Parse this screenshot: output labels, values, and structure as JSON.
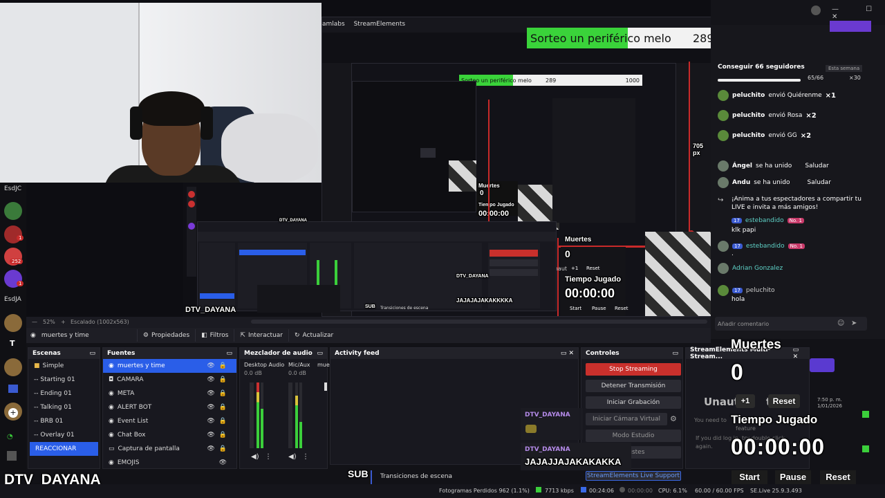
{
  "goal": {
    "title": "Sorteo un periférico melo",
    "current": "289",
    "target": "1000"
  },
  "webcam_name": "DTV_DAYANA",
  "left_labels": [
    "EsdJC",
    "EsdJA"
  ],
  "left_badges": [
    "252",
    "1",
    "1"
  ],
  "obs_menu": [
    "amlabs",
    "StreamElements"
  ],
  "nested": {
    "goal_title": "Sorteo un periférico melo",
    "goal_current": "289",
    "goal_target": "1000",
    "muertes": "Muertes",
    "muertes_val": "0",
    "tiempo": "Tiempo Jugado",
    "tiempo_val": "00:00:00",
    "dim_label": "705 px",
    "start": "Start",
    "pause": "Pause",
    "reset": "Reset",
    "plus": "+1",
    "name": "DTV_DAYANA",
    "sub": "SUB",
    "trans": "Transiciones de escena",
    "jaja": "JAJAJAJAKAKKKKA",
    "unaut": "Unaut"
  },
  "chat": {
    "goal": "Conseguir 66 seguidores",
    "goal_period": "Esta semana",
    "goal_progress": "65/66",
    "goal_reward": "×30",
    "gifts": [
      {
        "user": "peluchito",
        "text": "envió Quiérenme",
        "mult": "×1"
      },
      {
        "user": "peluchito",
        "text": "envió Rosa",
        "mult": "×2"
      },
      {
        "user": "peluchito",
        "text": "envió GG",
        "mult": "×2"
      }
    ],
    "joins": [
      {
        "user": "Ángel",
        "text": "se ha unido",
        "action": "Saludar"
      },
      {
        "user": "Andu",
        "text": "se ha unido",
        "action": "Saludar"
      }
    ],
    "share": "¡Anima a tus espectadores a compartir tu LIVE e invita a más amigos!",
    "messages": [
      {
        "level": "17",
        "user": "estebandido",
        "badge": "No. 1",
        "text": "klk papi"
      },
      {
        "level": "17",
        "user": "estebandido",
        "badge": "No. 1",
        "text": "."
      },
      {
        "user": "Adrian Gonzalez",
        "text": ""
      },
      {
        "level": "17",
        "user": "peluchito",
        "text": "hola"
      }
    ],
    "comment_placeholder": "Añadir comentario"
  },
  "status_row": {
    "zoom": "52%",
    "scale": "Escalado (1002x563)"
  },
  "source_bar": {
    "source": "muertes y time",
    "props": "Propiedades",
    "filters": "Filtros",
    "interact": "Interactuar",
    "update": "Actualizar"
  },
  "scenes": {
    "title": "Escenas",
    "items": [
      "Simple",
      "-- Starting 01",
      "-- Ending 01",
      "-- Talking 01",
      "-- BRB 01",
      "-- Overlay 01",
      "REACCIONAR"
    ]
  },
  "sources": {
    "title": "Fuentes",
    "items": [
      "muertes y time",
      "CAMARA",
      "META",
      "ALERT BOT",
      "Event List",
      "Chat Box",
      "Captura de pantalla",
      "EMOJIS"
    ]
  },
  "mixer": {
    "title": "Mezclador de audio",
    "channels": [
      {
        "name": "Desktop Audio",
        "db": "0.0 dB"
      },
      {
        "name": "Mic/Aux",
        "db": "0.0 dB"
      },
      {
        "name": "mue",
        "db": ""
      }
    ]
  },
  "activity": {
    "title": "Activity feed"
  },
  "controls": {
    "title": "Controles",
    "buttons": [
      "Stop Streaming",
      "Detener Transmisión",
      "Iniciar Grabación",
      "Iniciar Cámara Virtual",
      "Modo Estudio",
      "Ajustes"
    ],
    "support": "StreamElements Live Support"
  },
  "se_dock": {
    "title": "StreamElements Multi-Stream...",
    "unaut": "Unaut",
    "tic": "tic",
    "need": "You need to",
    "feature": "feature",
    "login": "If you did log in, try double-click",
    "again": "again.",
    "date": "7:50 p. m.",
    "date2": "1/01/2026"
  },
  "overlay": {
    "muertes": "Muertes",
    "muertes_val": "0",
    "plus": "+1",
    "reset": "Reset",
    "tiempo": "Tiempo Jugado",
    "tiempo_val": "00:00:00",
    "start": "Start",
    "pause": "Pause",
    "reset2": "Reset"
  },
  "alert_boxes": [
    {
      "name": "DTV_DAYANA",
      "text": ""
    },
    {
      "name": "DTV_DAYANA",
      "text": "JAJAJJAJAKAKAKKA"
    }
  ],
  "sub_label": "SUB",
  "transitions": "Transiciones de escena",
  "bottom": {
    "frames": "Fotogramas Perdidos 962 (1.1%)",
    "kbps": "7713 kbps",
    "live": "00:24:06",
    "rec": "00:00:00",
    "cpu": "CPU: 6.1%",
    "fps": "60.00 / 60.00 FPS",
    "version": "SE.Live 25.9.3.493"
  },
  "colors": {
    "accent": "#2a5ee8",
    "stop": "#c9302c",
    "goal_fill": "#3ad33a",
    "meter_green": "#3bcf3b"
  }
}
